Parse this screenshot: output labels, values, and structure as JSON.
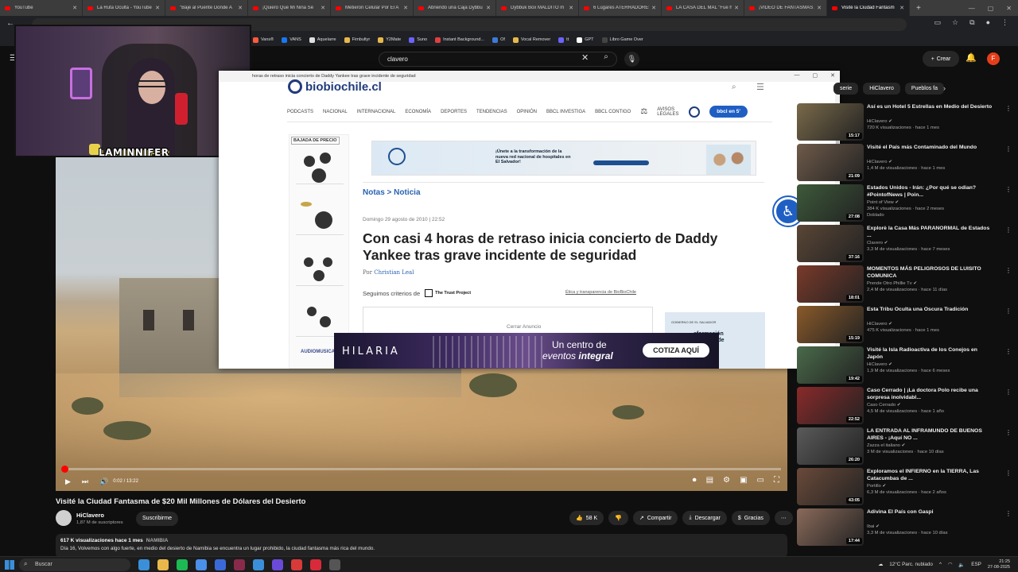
{
  "tabs": [
    {
      "label": "YouTube"
    },
    {
      "label": "La Ruta Oculta - YouTube"
    },
    {
      "label": "\"Bajé al Puente Donde A"
    },
    {
      "label": "¡Quiero Que Mi Niña Se"
    },
    {
      "label": "Metieron Celular Por El A"
    },
    {
      "label": "Abriendo una Caja Dybbu"
    },
    {
      "label": "Dybbuk Box MALDITO m"
    },
    {
      "label": "6 Lugares ATERRADORES"
    },
    {
      "label": "LA CASA DEL MAL \"Fue h"
    },
    {
      "label": "¡VÍDEO DE FANTASMAS A"
    },
    {
      "label": "Visité la Ciudad Fantasm"
    }
  ],
  "tab_new": "+",
  "bookmarks": [
    "Vans®",
    "VANS",
    "Aquelarre",
    "Fimbultyr",
    "Y2Mate",
    "Suno",
    "Instant Background...",
    "Of",
    "Vocal Remover",
    "tt",
    "GPT",
    "Libro Game Over"
  ],
  "bookmark_colors": [
    "#ff5a3c",
    "#1877f2",
    "#e0e0e0",
    "#e8b84a",
    "#e8b84a",
    "#6c63ff",
    "#e04040",
    "#3c7bd8",
    "#e8b84a",
    "#6c63ff",
    "#ffffff",
    "#444444",
    "#e8703c"
  ],
  "yt": {
    "search_value": "clavero",
    "create_label": "Crear",
    "avatar_letter": "F",
    "chips": [
      "serie",
      "HiClavero",
      "Pueblos fa"
    ]
  },
  "webcam": {
    "name": "LAMINNIFER"
  },
  "popup": {
    "title": "horas de retraso inicia concierto de Daddy Yankee tras grave incidente de seguridad",
    "logo": "biobiochile.cl",
    "nav": [
      "PODCASTS",
      "NACIONAL",
      "INTERNACIONAL",
      "ECONOMÍA",
      "DEPORTES",
      "TENDENCIAS",
      "OPINIÓN",
      "BBCL INVESTIGA",
      "BBCL CONTIGO"
    ],
    "avisos": "AVISOS LEGALES",
    "live_label": "bbcl en 5'",
    "side_ad_title": "BAJADA DE PRECIO",
    "side_ad_logo": "AUDIOMUSICA",
    "top_ad_text": "¡Únete a la transformación de la nueva red nacional de hospitales en El Salvador!",
    "breadcrumb": "Notas > Noticia",
    "date": "Domingo 29 agosto de 2010 | 22:52",
    "headline": "Con casi 4 horas de retraso inicia concierto de Daddy Yankee tras grave incidente de seguridad",
    "author_prefix": "Por",
    "author": "Christian Leal",
    "trust_label": "Seguimos criterios de",
    "trust_logo": "The Trust Project",
    "ethics": "Ética y transparencia de BioBioChile",
    "close_ad": "Cerrar Anuncio",
    "right_ad_text": "sformación\nnacional de\nales en\nador!",
    "right_ad_seal": "GOBIERNO DE EL SALVADOR"
  },
  "banner": {
    "logo": "HILARIA",
    "tag1": "Un centro de",
    "tag2_prefix": "eventos",
    "tag2_bold": "integral",
    "cta": "COTIZA AQUÍ"
  },
  "player": {
    "time": "0:02 / 13:22",
    "progress_fraction": 0.0025
  },
  "video": {
    "title": "Visité la Ciudad Fantasma de $20 Mil Millones de Dólares del Desierto",
    "channel": "HiClavero",
    "subs": "1,87 M de suscriptores",
    "subscribe": "Suscribirme",
    "likes": "58 K",
    "share": "Compartir",
    "download": "Descargar",
    "thanks": "Gracias",
    "views": "617 K visualizaciones  hace 1 mes",
    "location": "NAMIBIA",
    "desc": "Día 16, Volvemos con algo fuerte, en medio del desierto de Namibia se encuentra un lugar prohibido, la ciudad fantasma más rica del mundo."
  },
  "recs": [
    {
      "title": "Así es un Hotel 5 Estrellas en Medio del Desierto",
      "channel": "HiClavero",
      "meta": "720 K visualizaciones · hace 1 mes",
      "dur": "15:17",
      "color": "#7a6a4a"
    },
    {
      "title": "Visité el País más Contaminado del Mundo",
      "channel": "HiClavero",
      "meta": "1,4 M de visualizaciones · hace 1 mes",
      "dur": "21:09",
      "color": "#6f5b4a"
    },
    {
      "title": "Estados Unidos - Irán: ¿Por qué se odian? #PointofNews | Poin...",
      "channel": "Point of View",
      "meta": "384 K visualizaciones · hace 2 meses",
      "badge": "Doblado",
      "dur": "27:08",
      "color": "#3d5a3a"
    },
    {
      "title": "Explorè la Casa Más PARANORMAL de Estados ...",
      "channel": "Clavero",
      "meta": "3,3 M de visualizaciones · hace 7 meses",
      "dur": "37:16",
      "color": "#5a4636"
    },
    {
      "title": "MOMENTOS MÁS PELIGROSOS DE LUISITO COMUNICA",
      "channel": "Prende Otro Phillie Tv",
      "meta": "2,4 M de visualizaciones · hace 11 días",
      "dur": "18:01",
      "color": "#7a3a2a"
    },
    {
      "title": "Esta Tribu Oculta una Oscura Tradición",
      "channel": "HiClavero",
      "meta": "475 K visualizaciones · hace 1 mes",
      "dur": "15:19",
      "color": "#8a5a2a"
    },
    {
      "title": "Visité la Isla Radioactiva de los Conejos en Japón",
      "channel": "HiClavero",
      "meta": "1,9 M de visualizaciones · hace 6 meses",
      "dur": "19:42",
      "color": "#4a6a4a"
    },
    {
      "title": "Caso Cerrado | ¡La doctora Polo recibe una sorpresa inolvidabl...",
      "channel": "Caso Cerrado",
      "meta": "4,5 M de visualizaciones · hace 1 año",
      "dur": "22:52",
      "color": "#8a2a2a"
    },
    {
      "title": "LA ENTRADA AL INFRAMUNDO DE BUENOS AIRES - ¡Aquí NO ...",
      "channel": "Zazza el italiano",
      "meta": "3 M de visualizaciones · hace 10 días",
      "dur": "26:20",
      "color": "#5a5a5a"
    },
    {
      "title": "Exploramos el INFIERNO en la TIERRA, Las Catacumbas de ...",
      "channel": "Portillo",
      "meta": "6,3 M de visualizaciones · hace 2 años",
      "dur": "43:05",
      "color": "#6a4a3a"
    },
    {
      "title": "Adivina El País con Gaspi",
      "channel": "Ibai",
      "meta": "3,3 M de visualizaciones · hace 10 días",
      "dur": "17:44",
      "color": "#8a6a5a"
    }
  ],
  "taskbar": {
    "search": "Buscar",
    "weather": "12°C  Parc. nublado",
    "lang": "ESP",
    "time": "21:25",
    "date": "27-08-2025",
    "app_colors": [
      "#3a8fd8",
      "#e8b84a",
      "#1db954",
      "#4a8fe8",
      "#3a6ad8",
      "#8a2a4a",
      "#3a8fd8",
      "#6a4ad8",
      "#d83a3a",
      "#d82a3a",
      "#555555"
    ]
  }
}
